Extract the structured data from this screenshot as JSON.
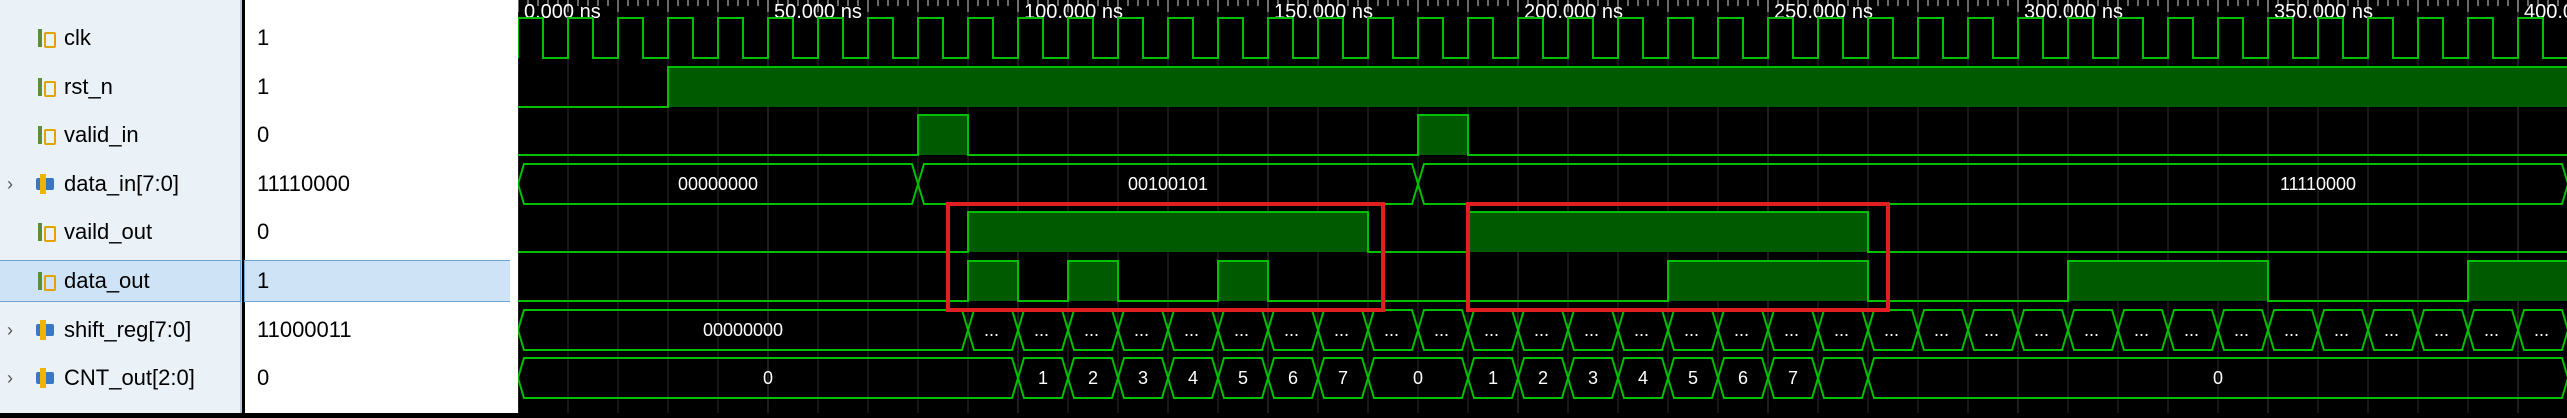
{
  "timeline": {
    "labels": [
      "0.000 ns",
      "50.000 ns",
      "100.000 ns",
      "150.000 ns",
      "200.000 ns",
      "250.000 ns",
      "300.000 ns",
      "350.000 ns",
      "400.0"
    ]
  },
  "signals": [
    {
      "name": "clk",
      "value": "1",
      "type": "bit"
    },
    {
      "name": "rst_n",
      "value": "1",
      "type": "bit"
    },
    {
      "name": "valid_in",
      "value": "0",
      "type": "bit"
    },
    {
      "name": "data_in[7:0]",
      "value": "11110000",
      "type": "bus"
    },
    {
      "name": "vaild_out",
      "value": "0",
      "type": "bit"
    },
    {
      "name": "data_out",
      "value": "1",
      "type": "bit"
    },
    {
      "name": "shift_reg[7:0]",
      "value": "11000011",
      "type": "bus"
    },
    {
      "name": "CNT_out[2:0]",
      "value": "0",
      "type": "bus"
    }
  ],
  "wave_labels": {
    "data_in": [
      "00000000",
      "00100101",
      "11110000"
    ],
    "shift_reg": [
      "00000000",
      "..."
    ],
    "cnt": [
      "0",
      "1",
      "2",
      "3",
      "4",
      "5",
      "6",
      "7",
      "0",
      "1",
      "2",
      "3",
      "4",
      "5",
      "6",
      "7",
      "0"
    ]
  },
  "colors": {
    "wave": "#00c000",
    "wave_fill": "#005a00",
    "bus_fill": "#000000",
    "grid": "#2c2c2c",
    "highlight": "#e02020"
  }
}
